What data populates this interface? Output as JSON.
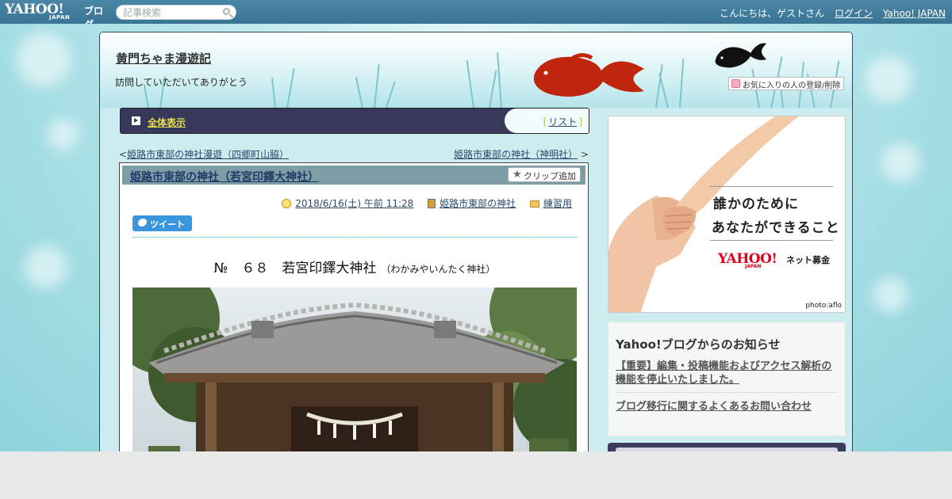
{
  "topbar": {
    "logo_yahoo": "YAHOO!",
    "logo_japan": "JAPAN",
    "logo_blog": "ブログ",
    "search_placeholder": "記事検索",
    "greeting": "こんにちは、ゲストさん",
    "login": "ログイン",
    "yahoo_japan": "Yahoo! JAPAN"
  },
  "blog": {
    "title": "黄門ちゃま漫遊記",
    "subtitle": "訪問していただいてありがとう",
    "favorite_button": "お気に入りの人の登録/削除"
  },
  "nav": {
    "all_label": "全体表示",
    "list_label": "リスト",
    "bracket_open": "[",
    "bracket_close": "]"
  },
  "pager": {
    "prev_arrow": "<",
    "prev_label": "姫路市東部の神社漫遊（四郷町山脇）",
    "next_label": "姫路市東部の神社（神明社）",
    "next_arrow": ">"
  },
  "article": {
    "title": "姫路市東部の神社（若宮印鐸大神社）",
    "clip_button": "クリップ追加",
    "date": "2018/6/16(土) 午前 11:28",
    "category": "姫路市東部の神社",
    "folder": "練習用",
    "tweet": "ツイート",
    "heading": "№　６８　若宮印鐸大神社",
    "heading_reading": "（わかみやいんたく神社）"
  },
  "ad": {
    "line1": "誰かのために",
    "line2": "あなたができること",
    "brand": "YAHOO!",
    "brand_sub": "JAPAN",
    "service": "ネット募金",
    "credit": "photo:aflo"
  },
  "notice": {
    "title": "Yahoo!ブログからのお知らせ",
    "link1": "【重要】編集・投稿機能およびアクセス解析の機能を停止いたしました。",
    "link2": "ブログ移行に関するよくあるお問い合わせ"
  },
  "colors": {
    "topbar": "#3f7b9b",
    "nav_bar": "#38385a",
    "nav_accent": "#e8e04a",
    "goldfish": "#c0250d",
    "tweet": "#3a96dc",
    "ad_brand": "#e0001a"
  },
  "icons": {
    "search": "magnifier-icon",
    "favorite": "heart-icon",
    "nav": "play-arrow-icon",
    "clip": "star-icon",
    "date": "clock-icon",
    "category": "book-icon",
    "folder": "folder-icon",
    "tweet": "twitter-bird-icon"
  }
}
